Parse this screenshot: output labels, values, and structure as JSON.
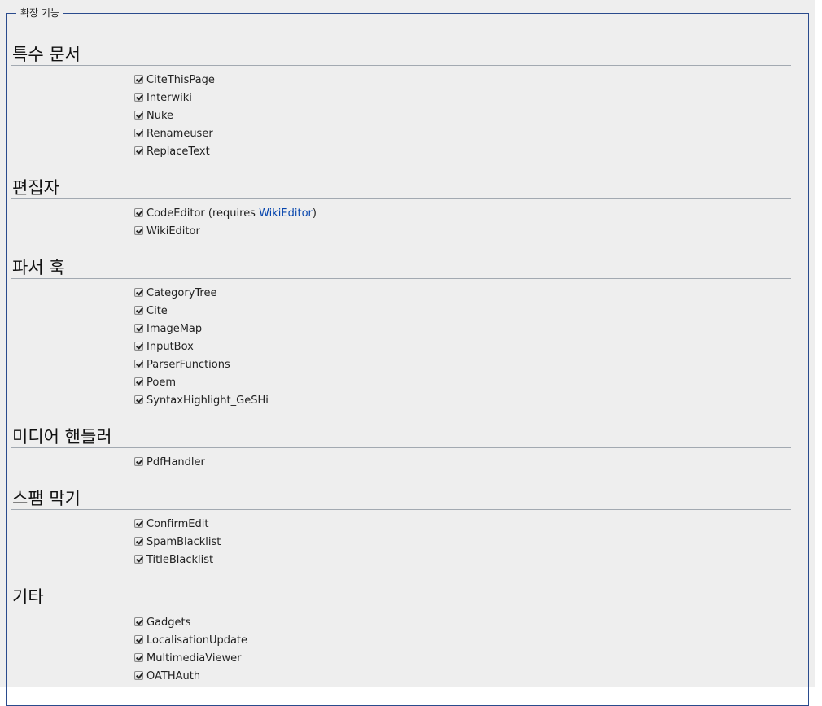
{
  "legend": "확장 기능",
  "sections": [
    {
      "title": "특수 문서",
      "items": [
        {
          "name": "CiteThisPage",
          "checked": true
        },
        {
          "name": "Interwiki",
          "checked": true
        },
        {
          "name": "Nuke",
          "checked": true
        },
        {
          "name": "Renameuser",
          "checked": true
        },
        {
          "name": "ReplaceText",
          "checked": true
        }
      ]
    },
    {
      "title": "편집자",
      "items": [
        {
          "name": "CodeEditor",
          "requires_prefix": " (requires ",
          "requires_link": "WikiEditor",
          "requires_suffix": ")",
          "checked": true
        },
        {
          "name": "WikiEditor",
          "checked": true
        }
      ]
    },
    {
      "title": "파서 훅",
      "items": [
        {
          "name": "CategoryTree",
          "checked": true
        },
        {
          "name": "Cite",
          "checked": true
        },
        {
          "name": "ImageMap",
          "checked": true
        },
        {
          "name": "InputBox",
          "checked": true
        },
        {
          "name": "ParserFunctions",
          "checked": true
        },
        {
          "name": "Poem",
          "checked": true
        },
        {
          "name": "SyntaxHighlight_GeSHi",
          "checked": true
        }
      ]
    },
    {
      "title": "미디어 핸들러",
      "items": [
        {
          "name": "PdfHandler",
          "checked": true
        }
      ]
    },
    {
      "title": "스팸 막기",
      "items": [
        {
          "name": "ConfirmEdit",
          "checked": true
        },
        {
          "name": "SpamBlacklist",
          "checked": true
        },
        {
          "name": "TitleBlacklist",
          "checked": true
        }
      ]
    },
    {
      "title": "기타",
      "items": [
        {
          "name": "Gadgets",
          "checked": true
        },
        {
          "name": "LocalisationUpdate",
          "checked": true
        },
        {
          "name": "MultimediaViewer",
          "checked": true
        },
        {
          "name": "OATHAuth",
          "checked": true
        }
      ]
    }
  ],
  "colors": {
    "link": "#0645ad",
    "fieldset_border": "#2a4b8d",
    "background": "#eeeeee"
  }
}
